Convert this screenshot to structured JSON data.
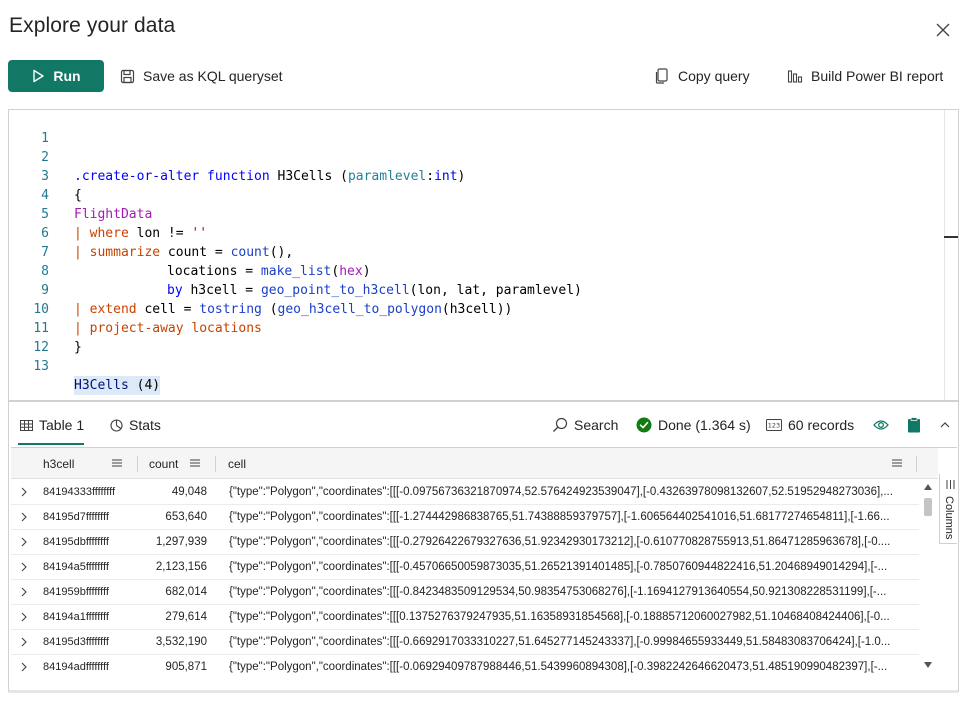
{
  "dialog": {
    "title": "Explore your data"
  },
  "toolbar": {
    "run_label": "Run",
    "save_label": "Save as KQL queryset",
    "copy_label": "Copy query",
    "powerbi_label": "Build Power BI report"
  },
  "editor": {
    "line_numbers": [
      "1",
      "2",
      "3",
      "4",
      "5",
      "6",
      "7",
      "8",
      "9",
      "10",
      "11",
      "12",
      "13"
    ],
    "lines": {
      "l2": {
        "a": ".create-or-alter function",
        "b": " H3Cells (",
        "c": "paramlevel",
        "d": ":",
        "e": "int",
        "f": ")"
      },
      "l3": "{",
      "l4": "FlightData",
      "l5": {
        "a": "| ",
        "b": "where",
        "c": " lon != ",
        "d": "''"
      },
      "l6": {
        "a": "| ",
        "b": "summarize",
        "c": " count = ",
        "d": "count",
        "e": "(),"
      },
      "l7": {
        "a": "locations = ",
        "b": "make_list",
        "c": "(",
        "d": "hex",
        "e": ")"
      },
      "l8": {
        "a": "by",
        "b": " h3cell = ",
        "c": "geo_point_to_h3cell",
        "d": "(lon, lat, paramlevel)"
      },
      "l9": {
        "a": "| ",
        "b": "extend",
        "c": " cell = ",
        "d": "tostring",
        "e": " (",
        "f": "geo_h3cell_to_polygon",
        "g": "(h3cell))"
      },
      "l10": {
        "a": "| ",
        "b": "project-away",
        "c": " locations"
      },
      "l11": "}",
      "l13": {
        "a": "H3Cells",
        "b": " (4)"
      }
    }
  },
  "results": {
    "tabs": [
      {
        "label": "Table 1",
        "icon": "table-icon"
      },
      {
        "label": "Stats",
        "icon": "stats-icon"
      }
    ],
    "search_label": "Search",
    "status_label": "Done (1.364 s)",
    "records_label": "60 records",
    "columns_label": "Columns",
    "columns": [
      "h3cell",
      "count",
      "cell"
    ],
    "rows": [
      {
        "h3cell": "84194333ffffffff",
        "count": "49,048",
        "cell": "{\"type\":\"Polygon\",\"coordinates\":[[[-0.09756736321870974,52.576424923539047],[-0.43263978098132607,52.51952948273036],..."
      },
      {
        "h3cell": "84195d7ffffffff",
        "count": "653,640",
        "cell": "{\"type\":\"Polygon\",\"coordinates\":[[[-1.274442986838765,51.74388859379757],[-1.606564402541016,51.68177274654811],[-1.66..."
      },
      {
        "h3cell": "84195dbffffffff",
        "count": "1,297,939",
        "cell": "{\"type\":\"Polygon\",\"coordinates\":[[[-0.27926422679327636,51.92342930173212],[-0.610770828755913,51.86471285963678],[-0...."
      },
      {
        "h3cell": "84194a5ffffffff",
        "count": "2,123,156",
        "cell": "{\"type\":\"Polygon\",\"coordinates\":[[[-0.45706650059873035,51.26521391401485],[-0.7850760944822416,51.20468949014294],[-..."
      },
      {
        "h3cell": "841959bffffffff",
        "count": "682,014",
        "cell": "{\"type\":\"Polygon\",\"coordinates\":[[[-0.8423483509129534,50.98354753068276],[-1.1694127913640554,50.921308228531199],[-..."
      },
      {
        "h3cell": "84194a1ffffffff",
        "count": "279,614",
        "cell": "{\"type\":\"Polygon\",\"coordinates\":[[[0.1375276379247935,51.16358931854568],[-0.18885712060027982,51.10468408424406],[-0..."
      },
      {
        "h3cell": "84195d3ffffffff",
        "count": "3,532,190",
        "cell": "{\"type\":\"Polygon\",\"coordinates\":[[[-0.6692917033310227,51.645277145243337],[-0.99984655933449,51.58483083706424],[-1.0..."
      },
      {
        "h3cell": "84194adffffffff",
        "count": "905,871",
        "cell": "{\"type\":\"Polygon\",\"coordinates\":[[[-0.06929409787988446,51.5439960894308],[-0.3982242646620473,51.485190990482397],[-..."
      }
    ]
  },
  "colors": {
    "accent": "#117865",
    "status_green": "#107c10"
  }
}
